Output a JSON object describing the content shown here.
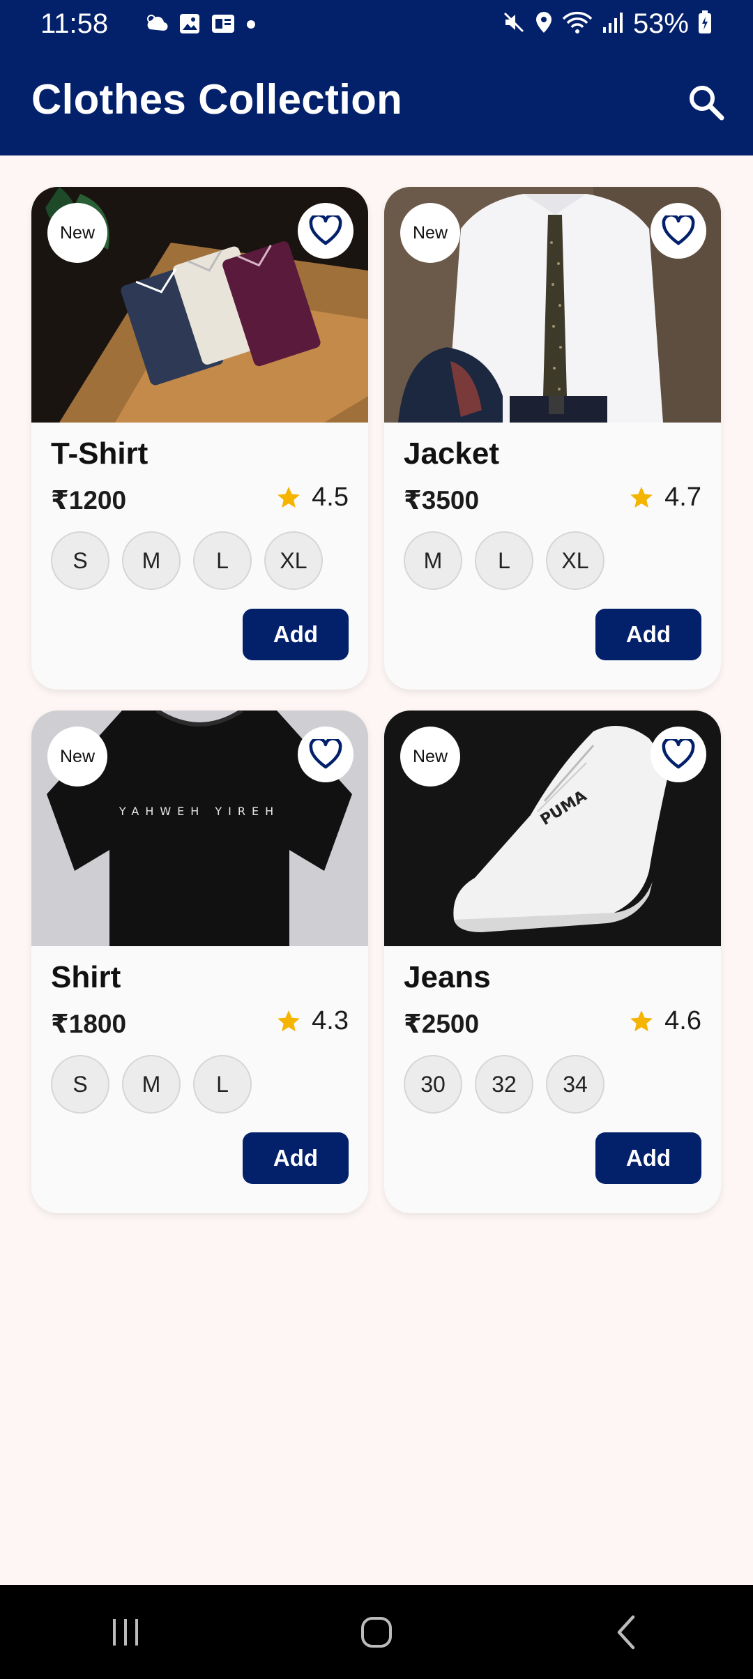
{
  "status_bar": {
    "time": "11:58",
    "battery": "53%",
    "left_icons": [
      "weather-icon",
      "gallery-icon",
      "news-icon",
      "dot-icon"
    ],
    "right_icons": [
      "mute-icon",
      "location-icon",
      "wifi-icon",
      "signal-icon",
      "battery-icon"
    ]
  },
  "app_bar": {
    "title": "Clothes Collection",
    "action_icon": "search-icon"
  },
  "colors": {
    "primary": "#03206B",
    "background": "#FDF6F4",
    "card": "#FAFAFA",
    "star": "#F4B400"
  },
  "products": [
    {
      "badge": "New",
      "name": "T-Shirt",
      "price": "₹1200",
      "rating": "4.5",
      "sizes": [
        "S",
        "M",
        "L",
        "XL"
      ],
      "add_label": "Add",
      "image": "folded-shirts-photo"
    },
    {
      "badge": "New",
      "name": "Jacket",
      "price": "₹3500",
      "rating": "4.7",
      "sizes": [
        "M",
        "L",
        "XL"
      ],
      "add_label": "Add",
      "image": "man-in-shirt-and-tie-photo"
    },
    {
      "badge": "New",
      "name": "Shirt",
      "price": "₹1800",
      "rating": "4.3",
      "sizes": [
        "S",
        "M",
        "L"
      ],
      "add_label": "Add",
      "image": "black-tshirt-photo",
      "image_text": "YAHWEH YIREH"
    },
    {
      "badge": "New",
      "name": "Jeans",
      "price": "₹2500",
      "rating": "4.6",
      "sizes": [
        "30",
        "32",
        "34"
      ],
      "add_label": "Add",
      "image": "white-sneaker-photo",
      "image_text": "PUMA"
    }
  ],
  "nav_bar": {
    "buttons": [
      "recents-icon",
      "home-icon",
      "back-icon"
    ]
  }
}
